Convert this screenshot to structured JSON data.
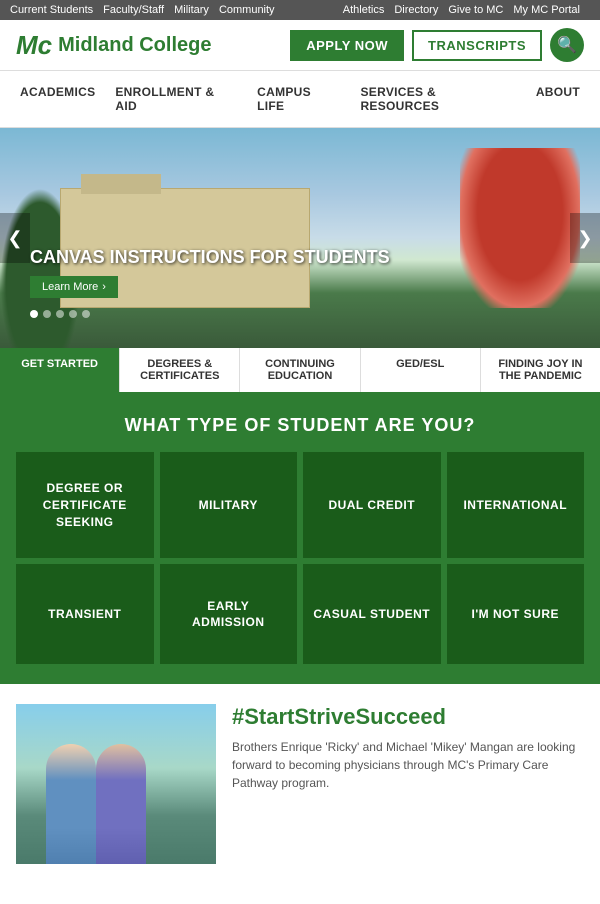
{
  "utility_bar": {
    "left_links": [
      "Current Students",
      "Faculty/Staff",
      "Military",
      "Community"
    ],
    "right_links": [
      "Athletics",
      "Directory",
      "Give to MC",
      "My MC Portal"
    ]
  },
  "header": {
    "logo_text": "Midland College",
    "logo_icon": "Mc",
    "apply_button": "APPLY NOW",
    "transcripts_button": "TRANSCRIPTS",
    "search_icon": "🔍"
  },
  "main_nav": {
    "items": [
      "ACADEMICS",
      "ENROLLMENT & AID",
      "CAMPUS LIFE",
      "SERVICES & RESOURCES",
      "ABOUT"
    ]
  },
  "hero": {
    "caption": "CANVAS INSTRUCTIONS FOR STUDENTS",
    "learn_more": "Learn More",
    "dots_count": 5,
    "active_dot": 0,
    "prev_arrow": "❮",
    "next_arrow": "❯"
  },
  "tabs": {
    "items": [
      "GET STARTED",
      "DEGREES & CERTIFICATES",
      "CONTINUING EDUCATION",
      "GED/ESL",
      "FINDING JOY IN THE PANDEMIC"
    ],
    "active_index": 0
  },
  "student_type": {
    "title": "WHAT TYPE OF STUDENT ARE YOU?",
    "cards": [
      "DEGREE OR CERTIFICATE SEEKING",
      "MILITARY",
      "DUAL CREDIT",
      "INTERNATIONAL",
      "TRANSIENT",
      "EARLY ADMISSION",
      "CASUAL STUDENT",
      "I'M NOT SURE"
    ]
  },
  "bottom": {
    "hashtag": "#StartStriveSucceed",
    "description": "Brothers Enrique 'Ricky' and Michael 'Mikey' Mangan are looking forward to becoming physicians through MC's Primary Care Pathway program."
  }
}
